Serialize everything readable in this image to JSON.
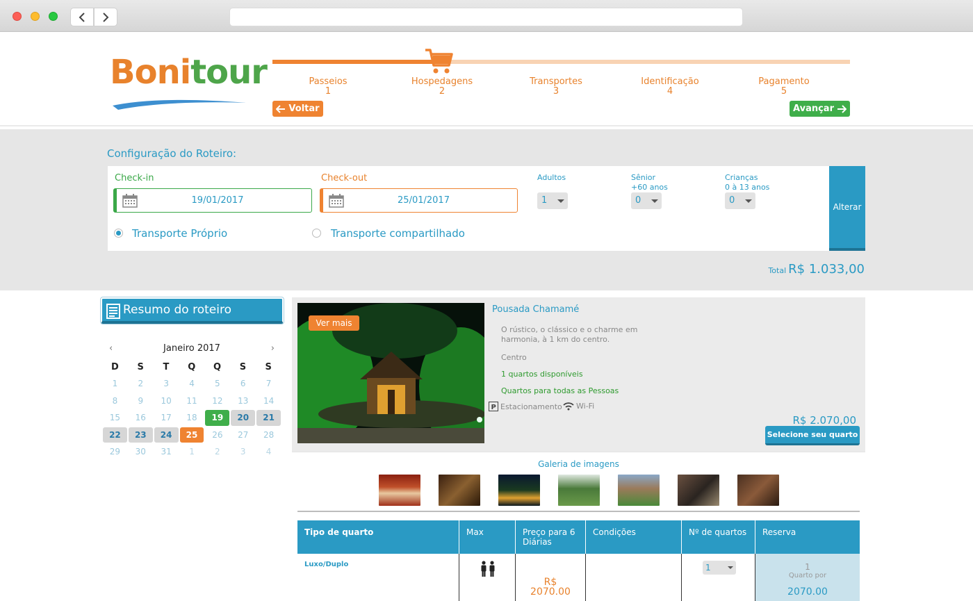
{
  "brand": {
    "logo_part1": "Boni",
    "logo_part2": "tour",
    "orange": "#ef8331",
    "green": "#3fae4a",
    "blue": "#2a9ac4"
  },
  "steps": [
    {
      "label": "Passeios",
      "num": "1"
    },
    {
      "label": "Hospedagens",
      "num": "2"
    },
    {
      "label": "Transportes",
      "num": "3"
    },
    {
      "label": "Identificação",
      "num": "4"
    },
    {
      "label": "Pagamento",
      "num": "5"
    }
  ],
  "progress": {
    "current_step": 2,
    "total_steps": 5
  },
  "nav": {
    "back": "Voltar",
    "next": "Avançar"
  },
  "config": {
    "title": "Configuração do Roteiro:",
    "checkin_label": "Check-in",
    "checkin_value": "19/01/2017",
    "checkout_label": "Check-out",
    "checkout_value": "25/01/2017",
    "adults_label": "Adultos",
    "adults_value": "1",
    "senior_label": "Sênior",
    "senior_sub": "+60 anos",
    "senior_value": "0",
    "children_label": "Crianças",
    "children_sub": "0 à 13 anos",
    "children_value": "0",
    "transport_own": "Transporte Próprio",
    "transport_shared": "Transporte compartilhado",
    "transport_selected": "own",
    "alter_button": "Alterar",
    "total_label": "Total",
    "total_value": "R$ 1.033,00"
  },
  "sidebar": {
    "resumo_title": "Resumo do roteiro",
    "calendar": {
      "month": "Janeiro 2017",
      "prev": "‹",
      "next": "›",
      "weekdays": [
        "D",
        "S",
        "T",
        "Q",
        "Q",
        "S",
        "S"
      ],
      "weeks": [
        [
          "1",
          "2",
          "3",
          "4",
          "5",
          "6",
          "7"
        ],
        [
          "8",
          "9",
          "10",
          "11",
          "12",
          "13",
          "14"
        ],
        [
          "15",
          "16",
          "17",
          "18",
          "19",
          "20",
          "21"
        ],
        [
          "22",
          "23",
          "24",
          "25",
          "26",
          "27",
          "28"
        ],
        [
          "29",
          "30",
          "31",
          "1",
          "2",
          "3",
          "4"
        ]
      ]
    }
  },
  "hotel": {
    "ver_mais": "Ver mais",
    "name": "Pousada Chamamé",
    "description": "O rústico, o clássico e o charme em harmonia, à 1 km do centro.",
    "location": "Centro",
    "availability": "1 quartos disponíveis",
    "rooms_for": "Quartos para todas as Pessoas",
    "amenity_parking": "Estacionamento",
    "amenity_wifi": "Wi-Fi",
    "price": "R$ 2.070,00",
    "select_button": "Selecione seu quarto"
  },
  "gallery": {
    "title": "Galeria de imagens"
  },
  "room_table": {
    "headers": [
      "Tipo de quarto",
      "Max",
      "Preço para 6 Diárias",
      "Condições",
      "Nº de quartos",
      "Reserva"
    ],
    "rows": [
      {
        "type": "Luxo/Duplo",
        "price_currency": "R$",
        "price": "2070.00",
        "rooms": "1",
        "reserva_qty": "1",
        "reserva_label": "Quarto por",
        "reserva_price": "2070.00"
      }
    ]
  }
}
